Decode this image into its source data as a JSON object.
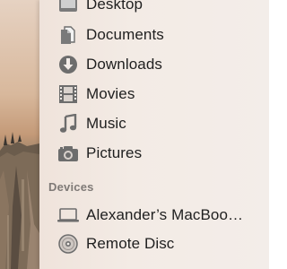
{
  "sidebar": {
    "favorites": [
      {
        "label": "Desktop",
        "icon": "desktop-folder-icon"
      },
      {
        "label": "Documents",
        "icon": "documents-icon"
      },
      {
        "label": "Downloads",
        "icon": "downloads-icon"
      },
      {
        "label": "Movies",
        "icon": "movies-icon"
      },
      {
        "label": "Music",
        "icon": "music-icon"
      },
      {
        "label": "Pictures",
        "icon": "pictures-icon"
      }
    ],
    "devices_header": "Devices",
    "devices": [
      {
        "label": "Alexander’s MacBoo…",
        "icon": "laptop-icon"
      },
      {
        "label": "Remote Disc",
        "icon": "remote-disc-icon"
      }
    ]
  },
  "colors": {
    "icon": "#6d6d6d",
    "text": "#1f1f1f",
    "header": "#7f7a77"
  }
}
